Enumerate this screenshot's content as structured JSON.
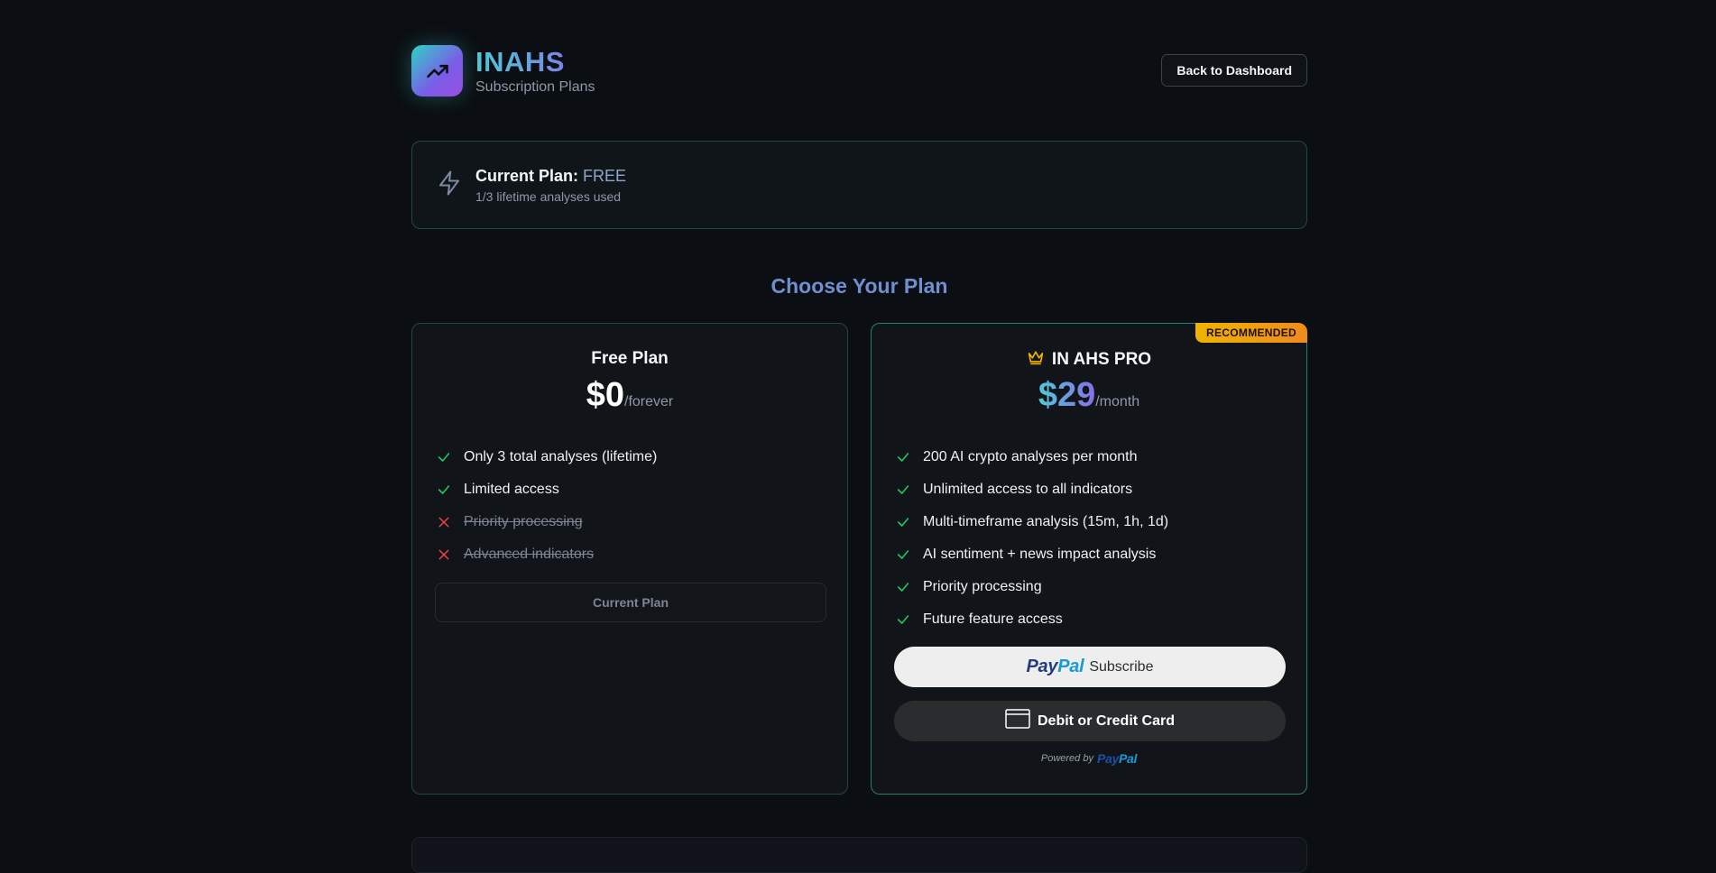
{
  "header": {
    "brand_title": "INAHS",
    "brand_subtitle": "Subscription Plans",
    "back_button": "Back to Dashboard"
  },
  "current_plan": {
    "label": "Current Plan:",
    "plan": "FREE",
    "usage": "1/3 lifetime analyses used"
  },
  "section_title": "Choose Your Plan",
  "plans": [
    {
      "title": "Free Plan",
      "price": "$0",
      "period": "/forever",
      "features": [
        {
          "label": "Only 3 total analyses (lifetime)",
          "included": true
        },
        {
          "label": "Limited access",
          "included": true
        },
        {
          "label": "Priority processing",
          "included": false
        },
        {
          "label": "Advanced indicators",
          "included": false
        }
      ],
      "button": "Current Plan"
    },
    {
      "title": "IN AHS PRO",
      "badge": "RECOMMENDED",
      "icon": "crown-icon",
      "price": "$29",
      "period": "/month",
      "features": [
        {
          "label": "200 AI crypto analyses per month",
          "included": true
        },
        {
          "label": "Unlimited access to all indicators",
          "included": true
        },
        {
          "label": "Multi-timeframe analysis (15m, 1h, 1d)",
          "included": true
        },
        {
          "label": "AI sentiment + news impact analysis",
          "included": true
        },
        {
          "label": "Priority processing",
          "included": true
        },
        {
          "label": "Future feature access",
          "included": true
        }
      ],
      "paypal_button": {
        "logo_pay": "Pay",
        "logo_pal": "Pal",
        "label": "Subscribe"
      },
      "card_button": "Debit or Credit Card",
      "powered_by": "Powered by"
    }
  ],
  "colors": {
    "accent_teal": "#2fd3c4",
    "accent_purple": "#8a6ee8",
    "check_green": "#22c55e",
    "cross_red": "#ef4444",
    "badge_orange": "#f0a50a"
  }
}
